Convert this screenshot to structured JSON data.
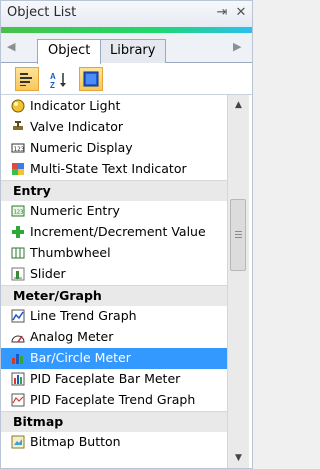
{
  "panel": {
    "title": "Object List",
    "pin_glyph": "⇥",
    "close_glyph": "✕"
  },
  "tabs": {
    "left_arrow": "◀",
    "right_arrow": "▶",
    "items": [
      {
        "label": "Object",
        "active": true
      },
      {
        "label": "Library",
        "active": false
      }
    ]
  },
  "toolbar": {
    "buttons": [
      "categorized-view-icon",
      "sort-alphabetical-icon",
      "display-icon"
    ]
  },
  "list": {
    "items": [
      {
        "kind": "item",
        "label": "Indicator Light",
        "icon": "indicator-light-icon"
      },
      {
        "kind": "item",
        "label": "Valve Indicator",
        "icon": "valve-indicator-icon"
      },
      {
        "kind": "item",
        "label": "Numeric Display",
        "icon": "numeric-display-icon"
      },
      {
        "kind": "item",
        "label": "Multi-State Text Indicator",
        "icon": "multistate-text-icon"
      },
      {
        "kind": "category",
        "label": "Entry"
      },
      {
        "kind": "item",
        "label": "Numeric Entry",
        "icon": "numeric-entry-icon"
      },
      {
        "kind": "item",
        "label": "Increment/Decrement Value",
        "icon": "increment-decrement-icon"
      },
      {
        "kind": "item",
        "label": "Thumbwheel",
        "icon": "thumbwheel-icon"
      },
      {
        "kind": "item",
        "label": "Slider",
        "icon": "slider-icon"
      },
      {
        "kind": "category",
        "label": "Meter/Graph"
      },
      {
        "kind": "item",
        "label": "Line Trend Graph",
        "icon": "line-trend-graph-icon"
      },
      {
        "kind": "item",
        "label": "Analog Meter",
        "icon": "analog-meter-icon"
      },
      {
        "kind": "item",
        "label": "Bar/Circle Meter",
        "icon": "bar-circle-meter-icon",
        "selected": true
      },
      {
        "kind": "item",
        "label": "PID Faceplate Bar Meter",
        "icon": "pid-bar-meter-icon"
      },
      {
        "kind": "item",
        "label": "PID Faceplate Trend Graph",
        "icon": "pid-trend-graph-icon"
      },
      {
        "kind": "category",
        "label": "Bitmap"
      },
      {
        "kind": "item",
        "label": "Bitmap Button",
        "icon": "bitmap-button-icon"
      }
    ]
  },
  "scrollbar": {
    "up_glyph": "▲",
    "down_glyph": "▼"
  },
  "colors": {
    "selection": "#3399ff",
    "accent_start": "#47c24a",
    "accent_end": "#2ac0f0"
  }
}
